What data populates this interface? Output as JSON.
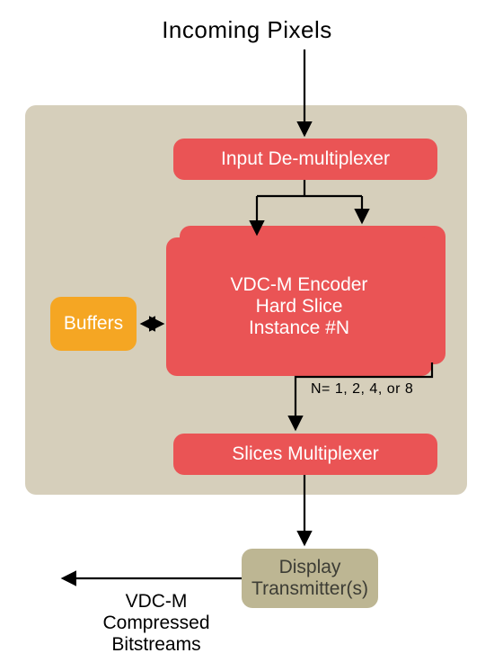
{
  "title": "Incoming Pixels",
  "blocks": {
    "demux": "Input De-multiplexer",
    "encoder_line1": "VDC-M Encoder",
    "encoder_line2": "Hard Slice",
    "encoder_line3": "Instance #N",
    "buffers": "Buffers",
    "slices_mux": "Slices Multiplexer",
    "display_tx": "Display\nTransmitter(s)"
  },
  "n_values": "N= 1, 2, 4, or 8",
  "output_label": "VDC-M\nCompressed\nBitstreams"
}
